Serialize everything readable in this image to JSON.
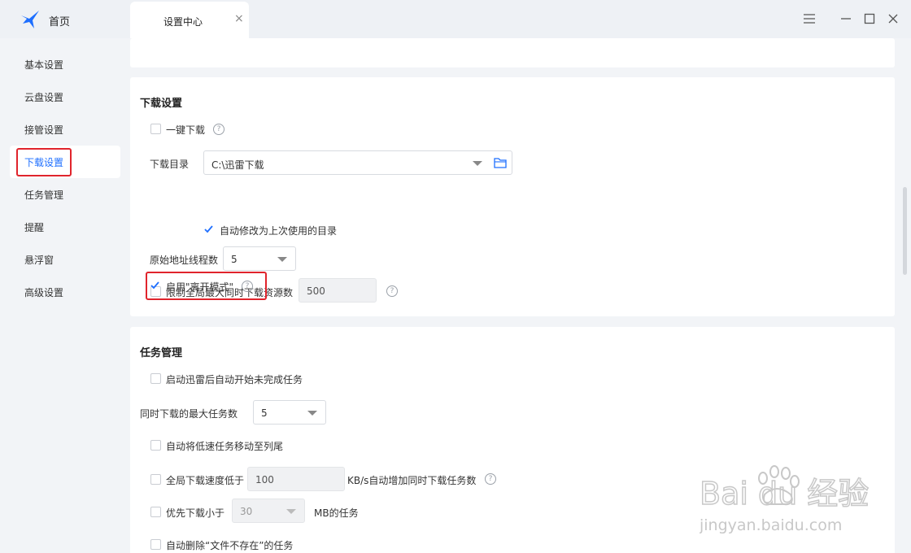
{
  "titlebar": {
    "home_label": "首页",
    "tab_label": "设置中心",
    "tab_close": "×"
  },
  "sidebar": {
    "items": [
      {
        "label": "基本设置"
      },
      {
        "label": "云盘设置"
      },
      {
        "label": "接管设置"
      },
      {
        "label": "下载设置",
        "active": true
      },
      {
        "label": "任务管理"
      },
      {
        "label": "提醒"
      },
      {
        "label": "悬浮窗"
      },
      {
        "label": "高级设置"
      }
    ]
  },
  "download": {
    "title": "下载设置",
    "one_click": {
      "label": "一键下载",
      "checked": false
    },
    "dir_label": "下载目录",
    "dir_value": "C:\\迅雷下载",
    "auto_modify": {
      "label": "自动修改为上次使用的目录",
      "checked": true
    },
    "threads_label": "原始地址线程数",
    "threads_value": "5",
    "limit": {
      "label": "限制全局最大同时下载资源数",
      "checked": false,
      "value": "500"
    },
    "away_mode": {
      "label": "启用\"离开模式\"",
      "checked": true
    }
  },
  "tasks": {
    "title": "任务管理",
    "auto_start": {
      "label": "启动迅雷后自动开始未完成任务",
      "checked": false
    },
    "max_tasks_label": "同时下载的最大任务数",
    "max_tasks_value": "5",
    "move_slow": {
      "label": "自动将低速任务移动至列尾",
      "checked": false
    },
    "speed_low": {
      "label": "全局下载速度低于",
      "checked": false,
      "value": "100",
      "suffix": "KB/s自动增加同时下载任务数"
    },
    "prefer_small": {
      "label": "优先下载小于",
      "checked": false,
      "value": "30",
      "suffix": "MB的任务"
    },
    "auto_delete": {
      "label": "自动删除“文件不存在”的任务",
      "checked": false
    }
  },
  "colors": {
    "accent": "#1e6fff",
    "highlight": "#e0242c"
  },
  "watermark": {
    "brand": "Bai du 经验",
    "url": "jingyan.baidu.com"
  }
}
